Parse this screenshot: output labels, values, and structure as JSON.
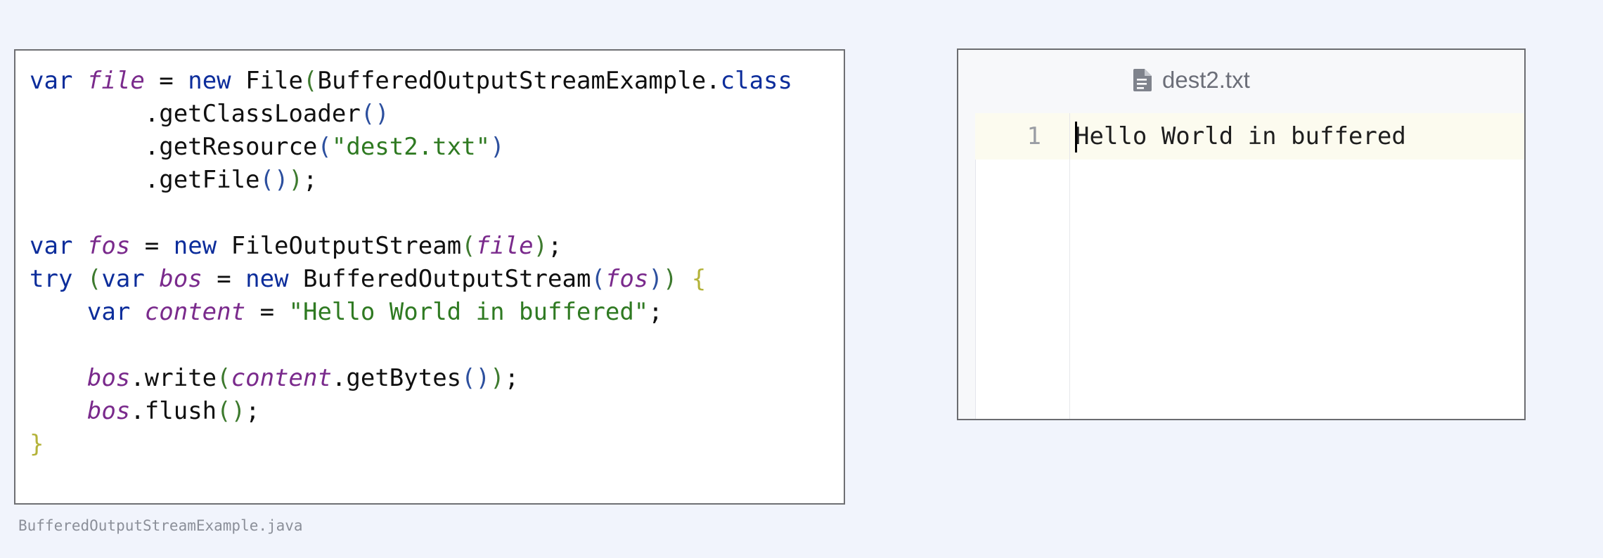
{
  "code_panel": {
    "lines": [
      [
        {
          "t": "var",
          "c": "kw"
        },
        {
          "t": " "
        },
        {
          "t": "file",
          "c": "var"
        },
        {
          "t": " = "
        },
        {
          "t": "new",
          "c": "kw"
        },
        {
          "t": " File"
        },
        {
          "t": "(",
          "c": "p1"
        },
        {
          "t": "BufferedOutputStreamExample."
        },
        {
          "t": "class",
          "c": "kw"
        }
      ],
      [
        {
          "t": "        .getClassLoader"
        },
        {
          "t": "()",
          "c": "p2"
        }
      ],
      [
        {
          "t": "        .getResource"
        },
        {
          "t": "(",
          "c": "p2"
        },
        {
          "t": "\"dest2.txt\"",
          "c": "str"
        },
        {
          "t": ")",
          "c": "p2"
        }
      ],
      [
        {
          "t": "        .getFile"
        },
        {
          "t": "()",
          "c": "p2"
        },
        {
          "t": ")",
          "c": "p1"
        },
        {
          "t": ";"
        }
      ],
      [],
      [
        {
          "t": "var",
          "c": "kw"
        },
        {
          "t": " "
        },
        {
          "t": "fos",
          "c": "var"
        },
        {
          "t": " = "
        },
        {
          "t": "new",
          "c": "kw"
        },
        {
          "t": " FileOutputStream"
        },
        {
          "t": "(",
          "c": "p1"
        },
        {
          "t": "file",
          "c": "var"
        },
        {
          "t": ")",
          "c": "p1"
        },
        {
          "t": ";"
        }
      ],
      [
        {
          "t": "try",
          "c": "kw"
        },
        {
          "t": " "
        },
        {
          "t": "(",
          "c": "p1"
        },
        {
          "t": "var",
          "c": "kw"
        },
        {
          "t": " "
        },
        {
          "t": "bos",
          "c": "var"
        },
        {
          "t": " = "
        },
        {
          "t": "new",
          "c": "kw"
        },
        {
          "t": " BufferedOutputStream"
        },
        {
          "t": "(",
          "c": "p2"
        },
        {
          "t": "fos",
          "c": "var"
        },
        {
          "t": ")",
          "c": "p2"
        },
        {
          "t": ")",
          "c": "p1"
        },
        {
          "t": " "
        },
        {
          "t": "{",
          "c": "br"
        }
      ],
      [
        {
          "t": "    "
        },
        {
          "t": "var",
          "c": "kw"
        },
        {
          "t": " "
        },
        {
          "t": "content",
          "c": "var"
        },
        {
          "t": " = "
        },
        {
          "t": "\"Hello World in buffered\"",
          "c": "str"
        },
        {
          "t": ";"
        }
      ],
      [],
      [
        {
          "t": "    "
        },
        {
          "t": "bos",
          "c": "var"
        },
        {
          "t": ".write"
        },
        {
          "t": "(",
          "c": "p1"
        },
        {
          "t": "content",
          "c": "var"
        },
        {
          "t": ".getBytes"
        },
        {
          "t": "()",
          "c": "p2"
        },
        {
          "t": ")",
          "c": "p1"
        },
        {
          "t": ";"
        }
      ],
      [
        {
          "t": "    "
        },
        {
          "t": "bos",
          "c": "var"
        },
        {
          "t": ".flush"
        },
        {
          "t": "()",
          "c": "p1"
        },
        {
          "t": ";"
        }
      ],
      [
        {
          "t": "}",
          "c": "br"
        }
      ]
    ]
  },
  "caption": "BufferedOutputStreamExample.java",
  "editor": {
    "tab": {
      "label": "dest2.txt",
      "icon": "text-file-icon"
    },
    "line_number": "1",
    "content": "Hello World in buffered"
  },
  "colors": {
    "keyword": "#0c2d9b",
    "variable": "#7a2a8c",
    "string": "#2f7a22",
    "background": "#f1f4fc"
  }
}
